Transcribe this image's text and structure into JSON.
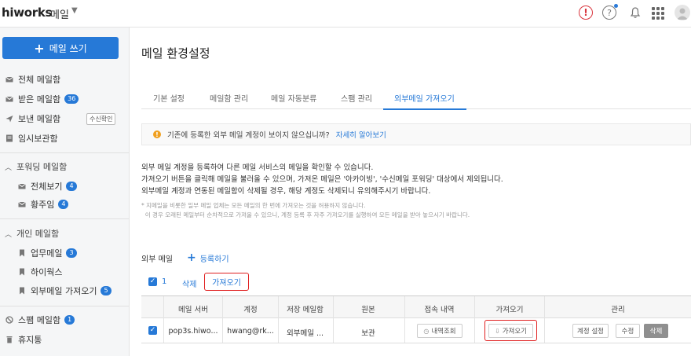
{
  "header": {
    "logo": "hiworks",
    "app_name": "메일",
    "alert_symbol": "!",
    "help_symbol": "?",
    "accent": "#2679d7",
    "alert_color": "#d9363e"
  },
  "sidebar": {
    "compose_label": "메일 쓰기",
    "mailboxes": [
      {
        "label": "전체 메일함",
        "icon": "mail-icon"
      },
      {
        "label": "받은 메일함",
        "badge": "36",
        "icon": "inbox-icon"
      },
      {
        "label": "보낸 메일함",
        "extra": "수신확인",
        "icon": "send-icon"
      },
      {
        "label": "임시보관함",
        "icon": "draft-icon"
      }
    ],
    "forwarding": {
      "title": "포워딩 메일함",
      "items": [
        {
          "label": "전체보기",
          "badge": "4"
        },
        {
          "label": "황주임",
          "badge": "4"
        }
      ]
    },
    "personal": {
      "title": "개인 메일함",
      "items": [
        {
          "label": "업무메일",
          "badge": "3"
        },
        {
          "label": "하이웍스"
        },
        {
          "label": "외부메일 가져오기",
          "badge": "5"
        }
      ]
    },
    "spam": {
      "label": "스팸 메일함",
      "badge": "1"
    },
    "trash": {
      "label": "휴지통"
    }
  },
  "main": {
    "title": "메일 환경설정",
    "tabs": [
      "기본 설정",
      "메일함 관리",
      "메일 자동분류",
      "스팸 관리",
      "외부메일 가져오기"
    ],
    "active_tab": 4,
    "notice": {
      "text": "기존에 등록한 외부 메일 계정이 보이지 않으십니까?",
      "link": "자세히 알아보기"
    },
    "description": [
      "외부 메일 계정을 등록하여 다른 메일 서비스의 메일을 확인할 수 있습니다.",
      "가져오기 버튼을 클릭해 메일을 불러올 수 있으며, 가져온 메일은 '아카이빙', '수신메일 포워딩' 대상에서 제외됩니다.",
      "외부메일 계정과 연동된 메일함이 삭제될 경우, 해당 계정도 삭제되니 유의해주시기 바랍니다."
    ],
    "small_notes": [
      "* 지메일을 비롯한 일부 메일 업체는 모든 메일의 한 번에 가져오는 것을 허용하지 않습니다.",
      "  이 경우 오래된 메일부터 순차적으로 가져올 수 있으니, 계정 등록 후 자주 가져오기를 실행하여 모든 메일을 받아 놓으시기 바랍니다."
    ],
    "external_label": "외부 메일",
    "register_label": "등록하기",
    "toolbar": {
      "selected_count": "1",
      "delete_label": "삭제",
      "fetch_label": "가져오기"
    },
    "table": {
      "headers": [
        "메일 서버",
        "계정",
        "저장 메일함",
        "원본",
        "접속 내역",
        "가져오기",
        "관리"
      ],
      "rows": [
        {
          "server": "pop3s.hiwo...",
          "account": "hwang@rk...",
          "mailbox": "외부메일 ...",
          "original": "보관",
          "history_btn": "내역조회",
          "fetch_btn": "가져오기",
          "manage": [
            "계정 설정",
            "수정",
            "삭제"
          ]
        }
      ]
    }
  }
}
